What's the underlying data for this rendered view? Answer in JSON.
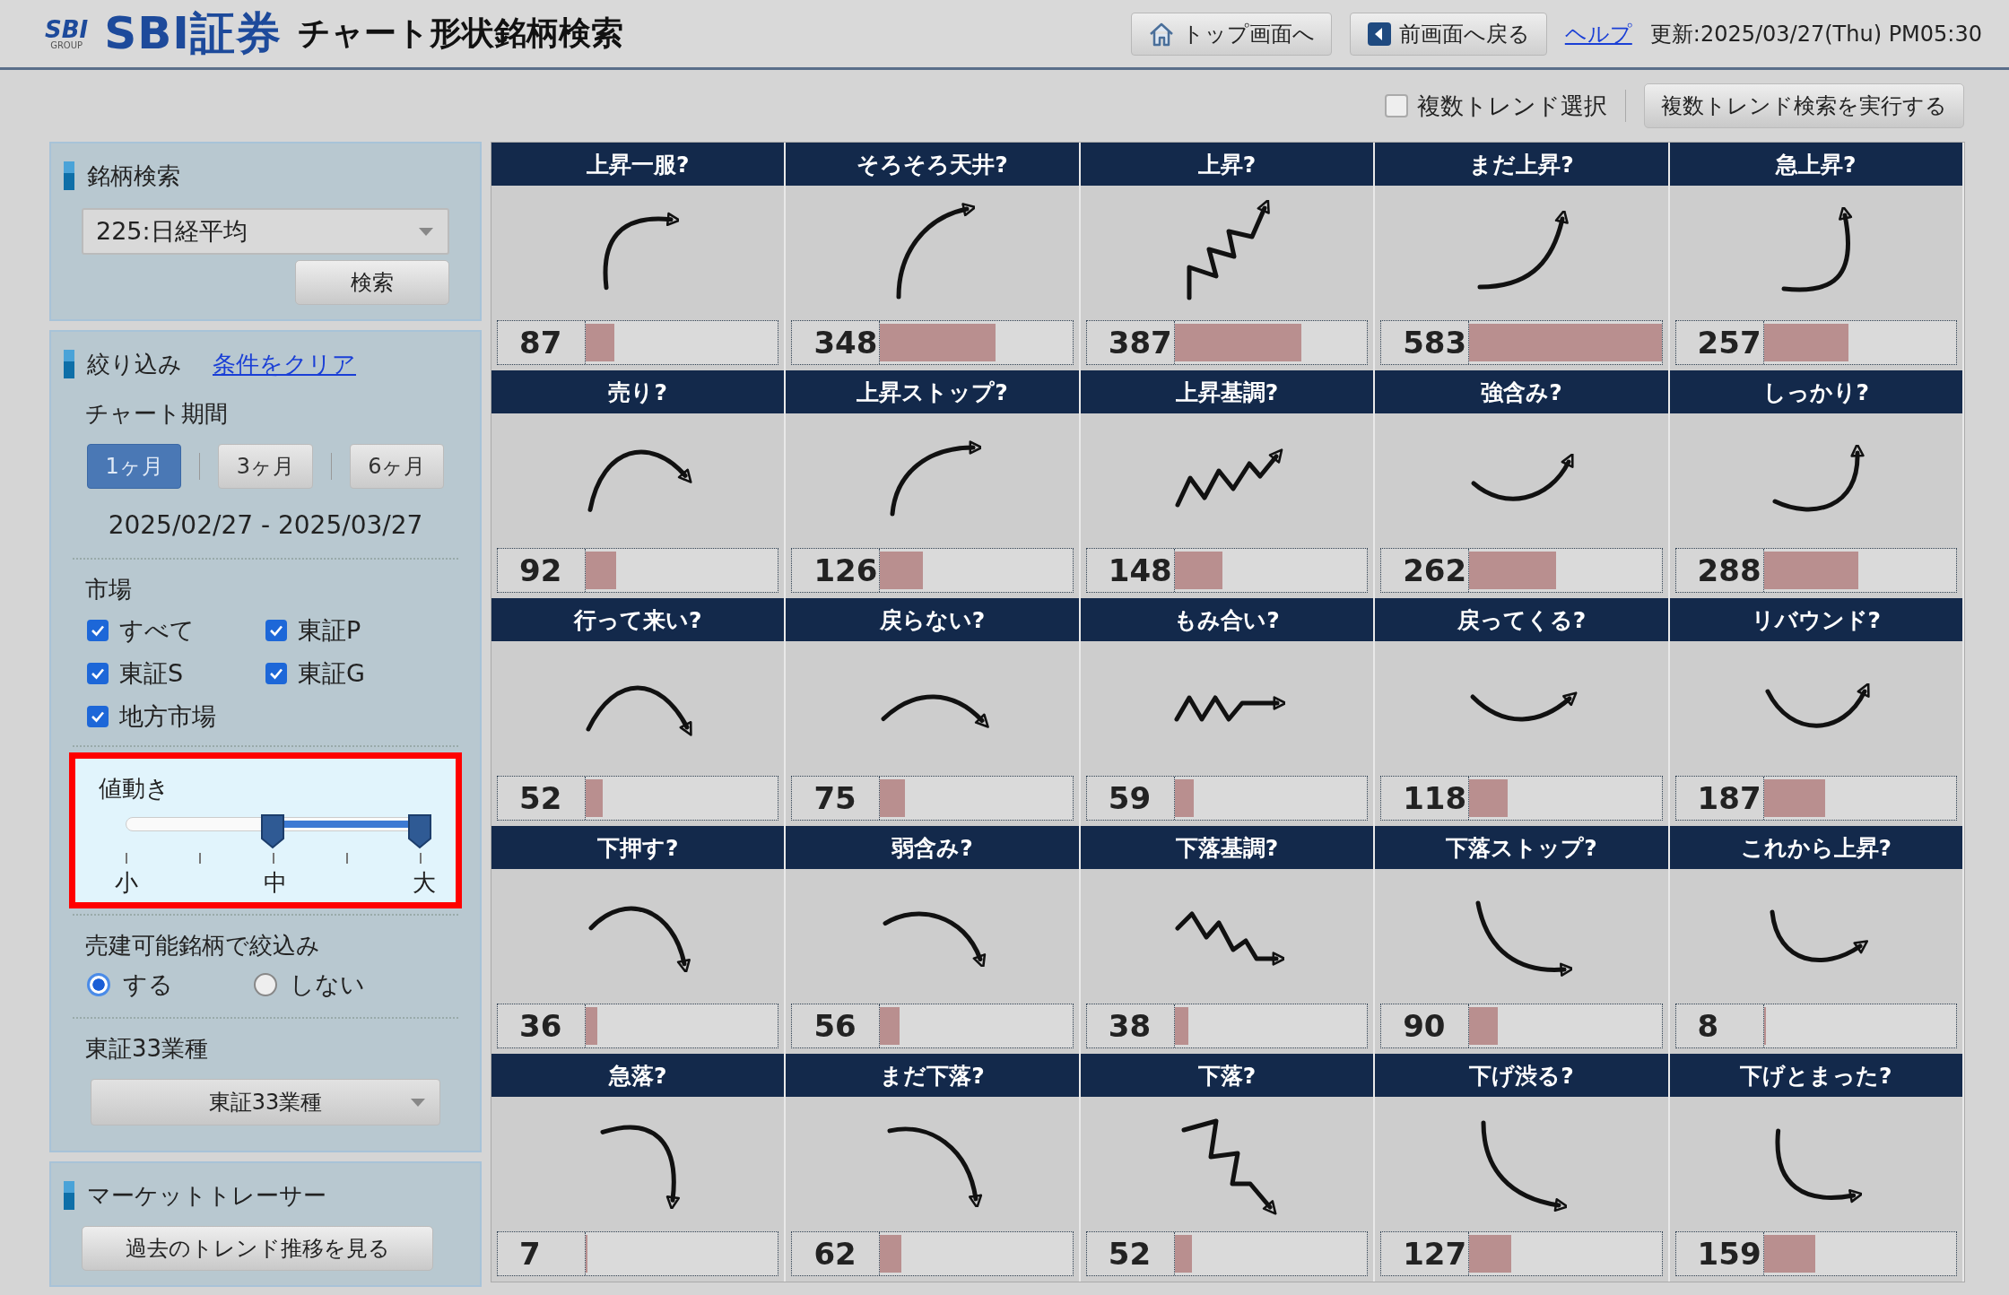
{
  "header": {
    "logo_mark": "SBI",
    "logo_sub": "GROUP",
    "brand": "SBI証券",
    "title": "チャート形状銘柄検索",
    "buttons": [
      {
        "kind": "home",
        "label": "トップ画面へ"
      },
      {
        "kind": "back",
        "label": "前画面へ戻る"
      }
    ],
    "help_link": "ヘルプ",
    "updated": "更新:2025/03/27(Thu) PM05:30"
  },
  "toolbar": {
    "multi_trend": {
      "label": "複数トレンド選択",
      "checked": false
    },
    "run_button": "複数トレンド検索を実行する"
  },
  "sidebar": {
    "search": {
      "title": "銘柄検索",
      "select_value": "225:日経平均",
      "button": "検索"
    },
    "filter": {
      "title": "絞り込み",
      "clear_link": "条件をクリア",
      "period_label": "チャート期間",
      "periods": [
        {
          "label": "1ヶ月",
          "selected": true
        },
        {
          "label": "3ヶ月",
          "selected": false
        },
        {
          "label": "6ヶ月",
          "selected": false
        }
      ],
      "date_range": "2025/02/27 - 2025/03/27",
      "market_label": "市場",
      "markets": [
        {
          "label": "すべて",
          "checked": true
        },
        {
          "label": "東証P",
          "checked": true
        },
        {
          "label": "東証S",
          "checked": true
        },
        {
          "label": "東証G",
          "checked": true
        },
        {
          "label": "地方市場",
          "checked": true
        }
      ],
      "volatility": {
        "label": "値動き",
        "highlighted": true,
        "thumbs": [
          {
            "level": 0.5
          },
          {
            "level": 1
          }
        ],
        "ticks": [
          "小",
          "中",
          "大"
        ]
      },
      "short_label": "売建可能銘柄で絞込み",
      "short_options": [
        {
          "label": "する",
          "selected": true
        },
        {
          "label": "しない",
          "selected": false
        }
      ],
      "sector_label": "東証33業種",
      "sector_select": "東証33業種"
    },
    "tracer": {
      "title": "マーケットトレーサー",
      "button": "過去のトレンド推移を見る"
    }
  },
  "patterns": [
    {
      "title": "上昇一服?",
      "kind": "pause",
      "count": "87",
      "level": 0.15
    },
    {
      "title": "そろそろ天井?",
      "kind": "topping",
      "count": "348",
      "level": 0.6
    },
    {
      "title": "上昇?",
      "kind": "climb",
      "count": "387",
      "level": 0.66
    },
    {
      "title": "まだ上昇?",
      "kind": "rising",
      "count": "583",
      "level": 1
    },
    {
      "title": "急上昇?",
      "kind": "surge",
      "count": "257",
      "level": 0.44
    },
    {
      "title": "売り?",
      "kind": "selloff",
      "count": "92",
      "level": 0.16
    },
    {
      "title": "上昇ストップ?",
      "kind": "stall",
      "count": "126",
      "level": 0.22
    },
    {
      "title": "上昇基調?",
      "kind": "uptrend",
      "count": "148",
      "level": 0.25
    },
    {
      "title": "強含み?",
      "kind": "firming",
      "count": "262",
      "level": 0.45
    },
    {
      "title": "しっかり?",
      "kind": "solid",
      "count": "288",
      "level": 0.49
    },
    {
      "title": "行って来い?",
      "kind": "roundtrip",
      "count": "52",
      "level": 0.09
    },
    {
      "title": "戻らない?",
      "kind": "holding",
      "count": "75",
      "level": 0.13
    },
    {
      "title": "もみ合い?",
      "kind": "range",
      "count": "59",
      "level": 0.1
    },
    {
      "title": "戻ってくる?",
      "kind": "return",
      "count": "118",
      "level": 0.2
    },
    {
      "title": "リバウンド?",
      "kind": "rebound",
      "count": "187",
      "level": 0.32
    },
    {
      "title": "下押す?",
      "kind": "pushdown",
      "count": "36",
      "level": 0.06
    },
    {
      "title": "弱含み?",
      "kind": "weakening",
      "count": "56",
      "level": 0.1
    },
    {
      "title": "下落基調?",
      "kind": "downtrend",
      "count": "38",
      "level": 0.07
    },
    {
      "title": "下落ストップ?",
      "kind": "bottoming",
      "count": "90",
      "level": 0.15
    },
    {
      "title": "これから上昇?",
      "kind": "turning",
      "count": "8",
      "level": 0.01
    },
    {
      "title": "急落?",
      "kind": "plunge",
      "count": "7",
      "level": 0.01
    },
    {
      "title": "まだ下落?",
      "kind": "falling",
      "count": "62",
      "level": 0.11
    },
    {
      "title": "下落?",
      "kind": "drop",
      "count": "52",
      "level": 0.09
    },
    {
      "title": "下げ渋る?",
      "kind": "resisting",
      "count": "127",
      "level": 0.22
    },
    {
      "title": "下げとまった?",
      "kind": "stopped",
      "count": "159",
      "level": 0.27
    }
  ]
}
